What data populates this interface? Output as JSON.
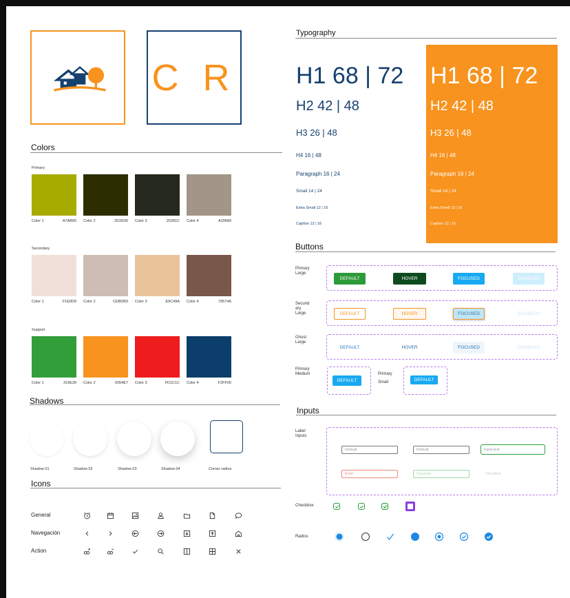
{
  "sections": {
    "colors": "Colors",
    "shadows": "Shadows",
    "icons": "Icons",
    "typography": "Typography",
    "buttons": "Buttons",
    "inputs": "Inputs"
  },
  "logo2_text": "C R",
  "palettes": [
    {
      "name": "Primary",
      "swatches": [
        {
          "label": "Color 1",
          "code": "A7AB00",
          "color": "#A7AB00"
        },
        {
          "label": "Color 2",
          "code": "2D2E00",
          "color": "#2D2E00"
        },
        {
          "label": "Color 3",
          "code": "25281C",
          "color": "#25281C"
        },
        {
          "label": "Color 4",
          "code": "A29689",
          "color": "#A29689"
        }
      ]
    },
    {
      "name": "Secondary",
      "swatches": [
        {
          "label": "Color 1",
          "code": "F1E0D9",
          "color": "#F1E0D9"
        },
        {
          "label": "Color 2",
          "code": "CEBDB3",
          "color": "#CEBDB3"
        },
        {
          "label": "Color 3",
          "code": "E9C49A",
          "color": "#E9C49A"
        },
        {
          "label": "Color 4",
          "code": "79574A",
          "color": "#79574A"
        }
      ]
    },
    {
      "name": "Support",
      "swatches": [
        {
          "label": "Color 1",
          "code": "319E39",
          "color": "#319E39"
        },
        {
          "label": "Color 2",
          "code": "6054E7",
          "color": "#F7931E"
        },
        {
          "label": "Color 3",
          "code": "FD1C1C",
          "color": "#EE1C1C"
        },
        {
          "label": "Color 4",
          "code": "F2FF00",
          "color": "#0B3E6B"
        }
      ]
    }
  ],
  "shadows": [
    "Shadow 01",
    "Shadow 02",
    "Shadow 03",
    "Shadow 04",
    "Corner radius"
  ],
  "icon_rows": [
    {
      "label": "General",
      "icons": [
        "alarm-clock-icon",
        "calendar-icon",
        "image-icon",
        "user-icon",
        "folder-icon",
        "document-icon",
        "chat-bubble-icon"
      ]
    },
    {
      "label": "Navegación",
      "icons": [
        "chevron-left-icon",
        "chevron-right-icon",
        "arrow-circle-left-icon",
        "arrow-circle-right-icon",
        "download-icon",
        "upload-icon",
        "home-icon"
      ]
    },
    {
      "label": "Action",
      "icons": [
        "link-add-icon",
        "link-remove-icon",
        "check-icon",
        "search-icon",
        "columns-icon",
        "grid-icon",
        "close-icon"
      ]
    }
  ],
  "typography": [
    {
      "text": "H1 68 | 72"
    },
    {
      "text": "H2 42 | 48"
    },
    {
      "text": "H3 26 | 48"
    },
    {
      "text": "H4 16 | 48"
    },
    {
      "text": "Paragraph 16 | 24"
    },
    {
      "text": "Small 14 | 24"
    },
    {
      "text": "Extra Small 12 | 16"
    },
    {
      "text": "Caption 12 | 16"
    }
  ],
  "button_groups": [
    {
      "label": "Primary\nLarge",
      "buttons": [
        "DEFAULT",
        "HOVER",
        "FOCUSED",
        "DISABLED"
      ]
    },
    {
      "label": "Secund\nary\nLarge",
      "buttons": [
        "DEFAULT",
        "HOVER",
        "FOCUSED",
        "DISABLED"
      ]
    },
    {
      "label": "Ghost\nLarge",
      "buttons": [
        "DEFAULT",
        "HOVER",
        "FOCUSED",
        "DISABLED"
      ]
    }
  ],
  "small_buttons": {
    "medium_label": "Primary\nMedium",
    "small_label": "Primary\nSmall",
    "default": "DEFAULT"
  },
  "inputs": {
    "label": "Label\nInputs",
    "fields": [
      "Default",
      "Default",
      "Input text",
      "Error",
      "Success",
      "Disabled"
    ]
  },
  "checkbox_label": "Checkbox",
  "radios_label": "Radios",
  "colors": {
    "orange": "#F7931E",
    "navy": "#16416E",
    "green": "#2E9B3A",
    "dark_green": "#0F4A1E",
    "cyan": "#18A9F0",
    "radio_blue": "#1E88E5",
    "dashed": "#B57CF0"
  }
}
